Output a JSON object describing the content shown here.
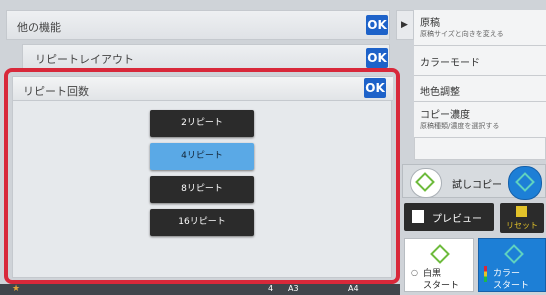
{
  "header": {
    "title": "他の機能",
    "ok": "OK"
  },
  "layout_row": {
    "label": "リピートレイアウト",
    "ok": "OK"
  },
  "dialog": {
    "title": "リピート回数",
    "ok": "OK",
    "options": [
      "2リピート",
      "4リピート",
      "8リピート",
      "16リピート"
    ],
    "selected": "4リピート"
  },
  "sidebar": {
    "items": [
      {
        "title": "原稿",
        "sub": "原稿サイズと向きを変える"
      },
      {
        "title": "カラーモード",
        "sub": ""
      },
      {
        "title": "地色調整",
        "sub": ""
      },
      {
        "title": "コピー濃度",
        "sub": "原稿種類/濃度を選択する"
      }
    ],
    "trial_copy": "試しコピー",
    "preview": "プレビュー",
    "reset": "リセット",
    "bw_start_1": "白黒",
    "bw_start_2": "スタート",
    "color_start_1": "カラー",
    "color_start_2": "スタート"
  },
  "bottom": {
    "a": "4",
    "b": "A3",
    "c": "A4"
  },
  "colors": {
    "accent": "#1d62c9",
    "highlight_border": "#d8283a",
    "selected": "#5aa9e6"
  }
}
